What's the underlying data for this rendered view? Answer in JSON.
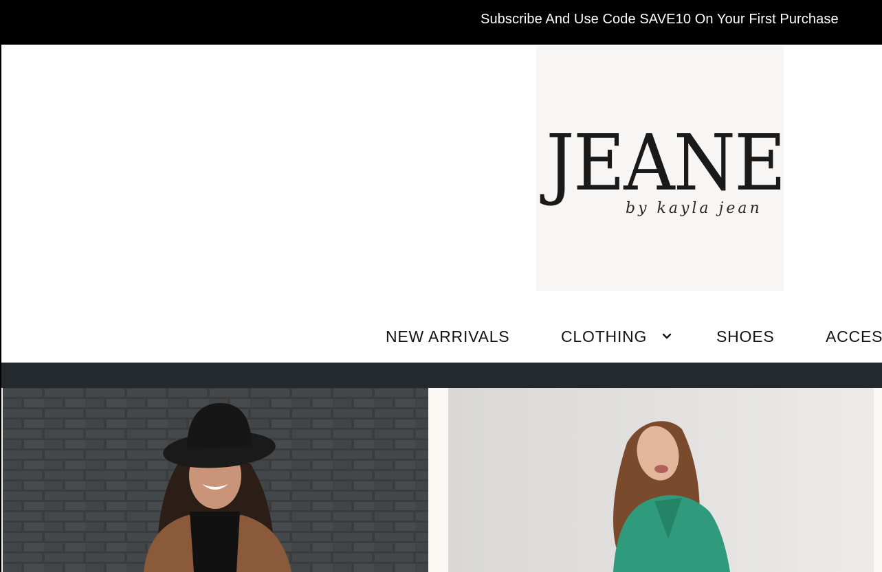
{
  "announcement": {
    "text": "Subscribe And Use Code SAVE10 On Your First Purchase"
  },
  "brand": {
    "name": "JEANE",
    "tagline": "by kayla jean"
  },
  "nav": {
    "items": [
      {
        "label": "NEW ARRIVALS",
        "has_dropdown": false
      },
      {
        "label": "CLOTHING",
        "has_dropdown": true
      },
      {
        "label": "SHOES",
        "has_dropdown": false
      },
      {
        "label": "ACCESS",
        "has_dropdown": false
      }
    ]
  },
  "colors": {
    "announcement_bg": "#000000",
    "band": "#23292d",
    "logo_bg": "#f8f6f4",
    "hero_bg": "#fcf8f4"
  },
  "hero": {
    "images": [
      {
        "icon": "woman-in-black-hat-photo"
      },
      {
        "icon": "woman-in-green-blouse-photo"
      }
    ]
  }
}
